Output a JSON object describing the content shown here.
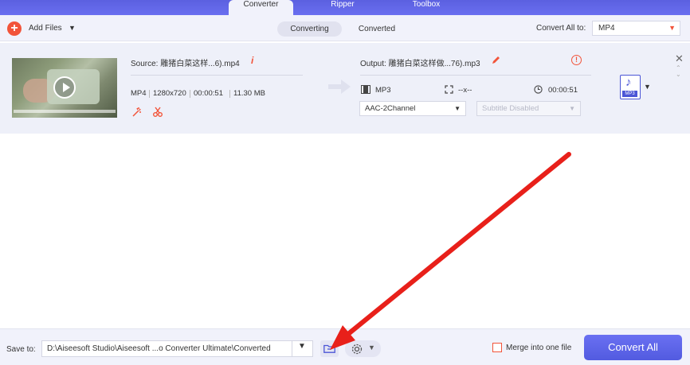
{
  "nav": {
    "tabs": [
      {
        "label": "Converter",
        "active": true
      },
      {
        "label": "Ripper",
        "active": false
      },
      {
        "label": "Toolbox",
        "active": false
      }
    ]
  },
  "toolbar": {
    "add_files_label": "Add Files",
    "segments": [
      "Converting",
      "Converted"
    ],
    "convert_all_label": "Convert All to:",
    "convert_all_value": "MP4"
  },
  "file": {
    "source_label": "Source: 雕猪白菜这样...6).mp4",
    "format": "MP4",
    "resolution": "1280x720",
    "duration": "00:00:51",
    "size": "11.30 MB",
    "output_label": "Output: 雕猪白菜这样做...76).mp3",
    "out_format": "MP3",
    "out_resolution": "--x--",
    "out_duration": "00:00:51",
    "audio_value": "AAC-2Channel",
    "subtitle_value": "Subtitle Disabled",
    "badge_label": "MP3"
  },
  "bottom": {
    "save_to_label": "Save to:",
    "save_path": "D:\\Aiseesoft Studio\\Aiseesoft ...o Converter Ultimate\\Converted",
    "merge_label": "Merge into one file",
    "convert_all_button": "Convert All"
  },
  "colors": {
    "accent": "#5b60e0",
    "danger": "#f2543a",
    "annotation_arrow": "#e8201a"
  }
}
